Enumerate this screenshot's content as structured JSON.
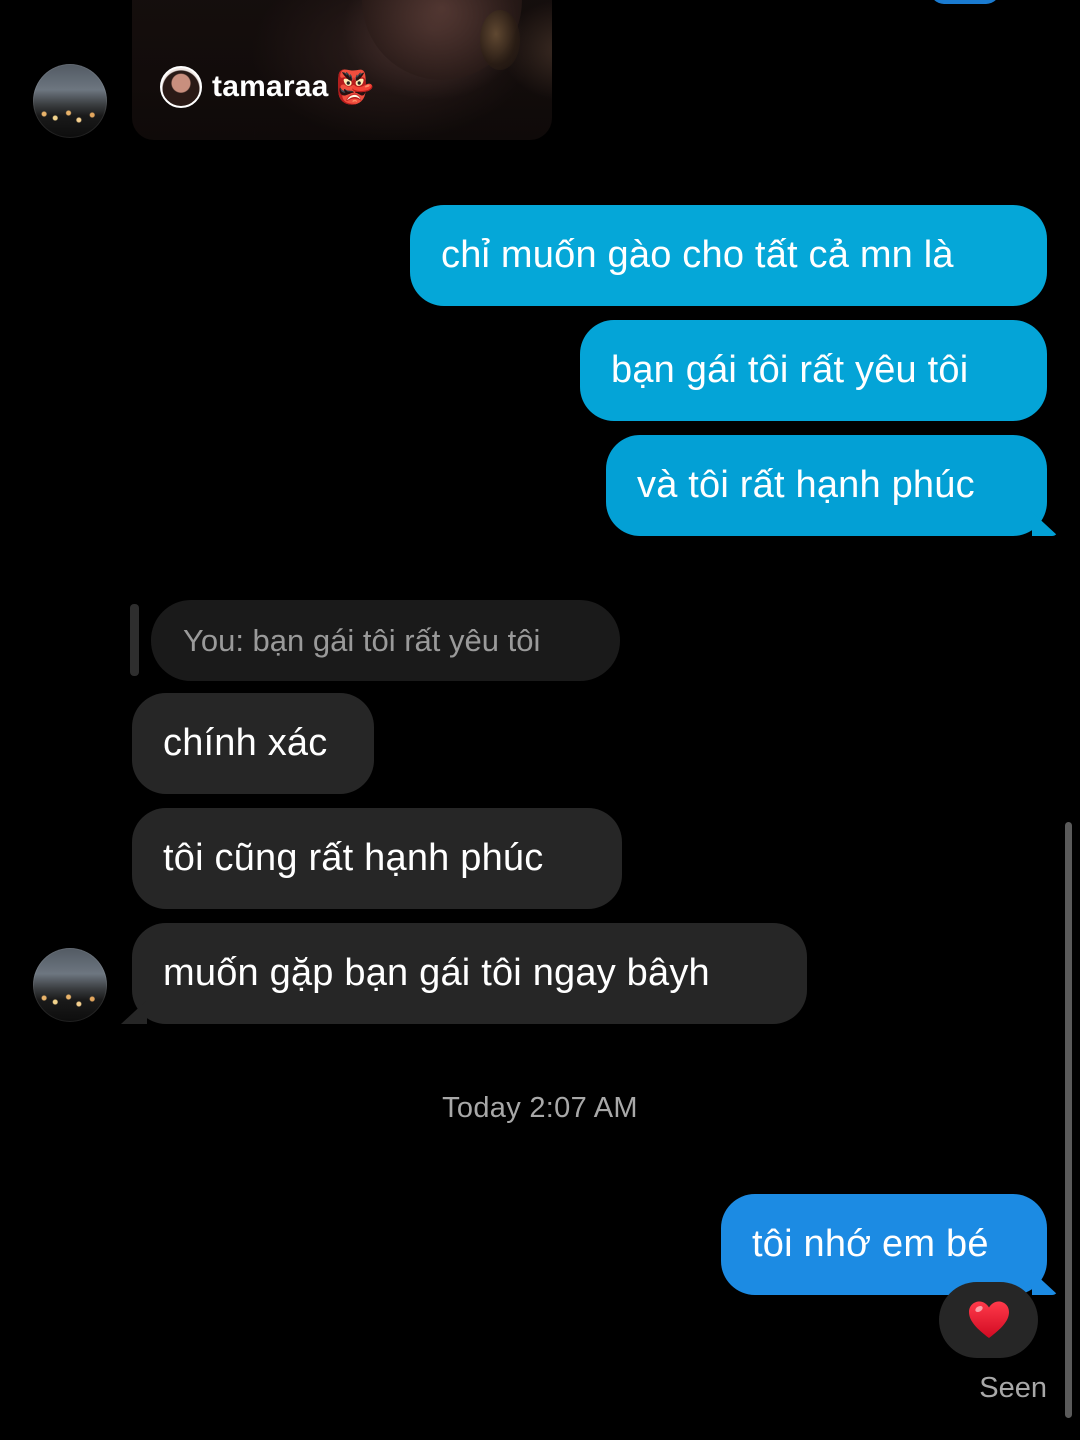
{
  "shared_post": {
    "owner_name": "tamaraa",
    "owner_emoji": "👺"
  },
  "messages": {
    "sent": [
      "chỉ muốn gào cho tất cả mn là",
      "bạn gái tôi rất yêu tôi",
      "và tôi rất hạnh phúc"
    ],
    "reply_quote": "You: bạn gái tôi rất yêu tôi",
    "received": [
      "chính xác",
      "tôi cũng rất hạnh phúc",
      "muốn gặp bạn gái tôi ngay bâyh"
    ],
    "timestamp": "Today 2:07 AM",
    "last_sent": "tôi nhớ em bé",
    "reaction": "heart-icon",
    "status": "Seen"
  },
  "colors": {
    "sent_bubble": "#04a3d6",
    "last_sent_bubble": "#1c8be3",
    "received_bubble": "#262626",
    "background": "#000000",
    "heart": "#e8132b"
  }
}
